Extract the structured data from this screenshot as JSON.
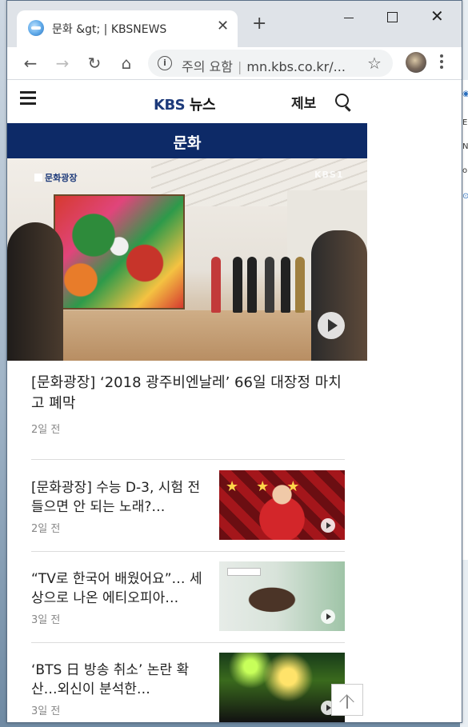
{
  "browser": {
    "tab_title": "문화 &gt; | KBSNEWS",
    "new_tab": "+",
    "tab_close": "✕",
    "url_warning": "주의 요함",
    "url_separator": "|",
    "url_text": "mn.kbs.co.kr/...",
    "controls": {
      "back": "←",
      "forward": "→",
      "reload": "↻",
      "home": "⌂",
      "star": "☆"
    }
  },
  "site": {
    "logo_kbs": "KBS",
    "logo_news": "뉴스",
    "tip_label": "제보",
    "section_title": "문화"
  },
  "hero": {
    "badge": "문화광장",
    "watermark": "KBS1",
    "title": "[문화광장] ‘2018 광주비엔날레’ 66일 대장정 마치고 폐막",
    "time": "2일 전"
  },
  "news": [
    {
      "title": "[문화광장] 수능 D-3, 시험 전 들으면 안 되는 노래?…",
      "time": "2일 전"
    },
    {
      "title": "“TV로 한국어 배웠어요”… 세상으로 나온 에티오피아…",
      "time": "3일 전"
    },
    {
      "title": "‘BTS 日 방송 취소’ 논란 확산…외신이 분석한…",
      "time": "3일 전"
    }
  ]
}
